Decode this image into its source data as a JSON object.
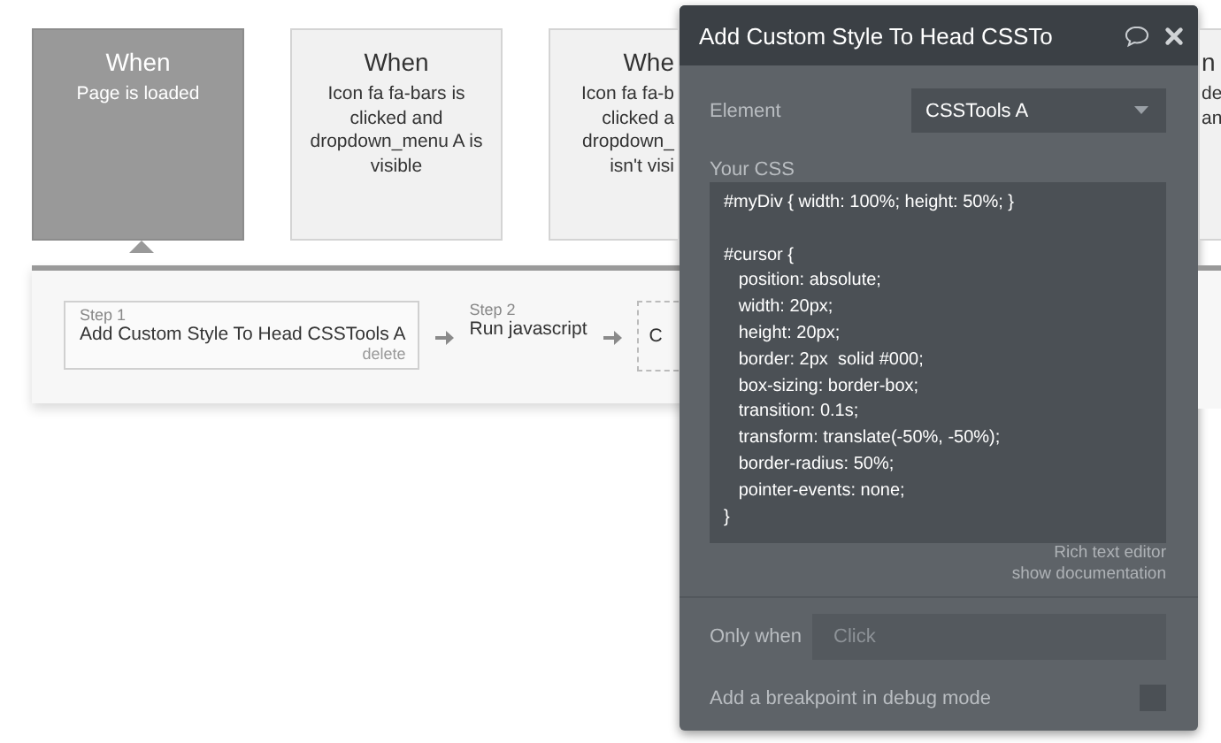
{
  "events": [
    {
      "title": "When",
      "description": [
        "Page is loaded"
      ],
      "selected": true
    },
    {
      "title": "When",
      "description": [
        "Icon fa fa-bars is",
        "clicked and",
        "dropdown_menu A is",
        "visible"
      ],
      "selected": false
    },
    {
      "title": "Whe",
      "description": [
        "Icon fa fa-b",
        "clicked a",
        "dropdown_",
        "isn't visi"
      ],
      "selected": false
    }
  ],
  "right_event": {
    "title": "n",
    "description": [
      "de",
      "an"
    ]
  },
  "steps": [
    {
      "label": "Step 1",
      "action": "Add Custom Style To Head CSSTools A",
      "delete": "delete",
      "kind": "card"
    },
    {
      "label": "Step 2",
      "action": "Run javascript",
      "kind": "plain"
    },
    {
      "action": "C",
      "kind": "placeholder"
    }
  ],
  "panel": {
    "title": "Add Custom Style To Head CSSTo",
    "element_label": "Element",
    "element_value": "CSSTools A",
    "css_label": "Your CSS",
    "css": "#myDiv { width: 100%; height: 50%; }\n\n#cursor {\n   position: absolute;\n   width: 20px;\n   height: 20px;\n   border: 2px  solid #000;\n   box-sizing: border-box;\n   transition: 0.1s;\n   transform: translate(-50%, -50%);\n   border-radius: 50%;\n   pointer-events: none;\n}",
    "links": [
      "Rich text editor",
      "show documentation"
    ],
    "only_when_label": "Only when",
    "only_when_placeholder": "Click",
    "breakpoint_label": "Add a breakpoint in debug mode",
    "breakpoint_checked": false
  }
}
